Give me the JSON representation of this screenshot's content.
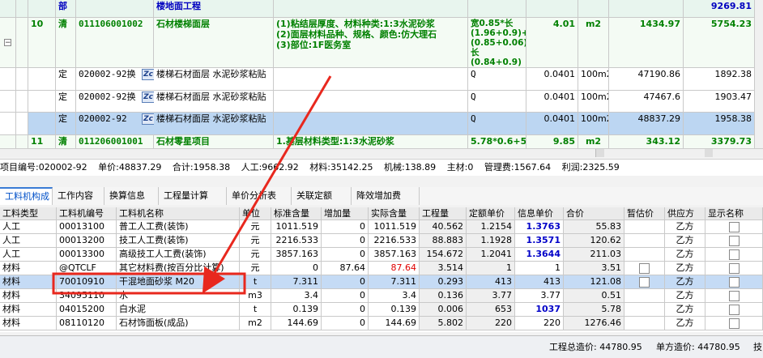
{
  "top_grid": {
    "rows": [
      {
        "type": "part",
        "seq": "",
        "kind": "部",
        "code": "",
        "name": "楼地面工程",
        "features": "",
        "formula": "",
        "qty": "",
        "unit": "",
        "price": "",
        "total": "9269.81"
      },
      {
        "type": "qd",
        "seq": "10",
        "kind": "清",
        "code": "011106001002",
        "name": "石材楼梯面层",
        "features": "(1)粘结层厚度、材料种类:1:3水泥砂浆\n(2)面层材料品种、规格、颜色:仿大理石\n(3)部位:1F医务室",
        "formula": "宽0.85*长(1.96+0.9)+宽(0.85+0.06)*长(0.84+0.9)",
        "qty": "4.01",
        "unit": "m2",
        "price": "1434.97",
        "total": "5754.23"
      },
      {
        "type": "de",
        "seq": "",
        "kind": "定",
        "code": "020002-92换",
        "name": "楼梯石材面层 水泥砂浆粘贴",
        "features": "",
        "formula": "Q",
        "qty": "0.0401",
        "unit": "100m2",
        "price": "47190.86",
        "total": "1892.38"
      },
      {
        "type": "de",
        "seq": "",
        "kind": "定",
        "code": "020002-92换",
        "name": "楼梯石材面层 水泥砂浆粘贴",
        "features": "",
        "formula": "Q",
        "qty": "0.0401",
        "unit": "100m2",
        "price": "47467.6",
        "total": "1903.47"
      },
      {
        "type": "sel",
        "seq": "",
        "kind": "定",
        "code": "020002-92",
        "name": "楼梯石材面层 水泥砂浆粘贴",
        "features": "",
        "formula": "Q",
        "qty": "0.0401",
        "unit": "100m2",
        "price": "48837.29",
        "total": "1958.38"
      },
      {
        "type": "qd2",
        "seq": "11",
        "kind": "清",
        "code": "011206001001",
        "name": "石材零星项目",
        "features": "1.基层材料类型:1:3水泥砂浆",
        "formula": "5.78*0.6+5",
        "qty": "9.85",
        "unit": "m2",
        "price": "343.12",
        "total": "3379.73"
      }
    ]
  },
  "info": {
    "code": "项目编号:020002-92",
    "unit_price": "单价:48837.29",
    "total": "合计:1958.38",
    "labor": "人工:9662.92",
    "material": "材料:35142.25",
    "machine": "机械:138.89",
    "main_mat": "主材:0",
    "mgmt": "管理费:1567.64",
    "profit": "利润:2325.59"
  },
  "tabs": [
    "工料机构成",
    "工作内容",
    "换算信息",
    "工程量计算",
    "单价分析表",
    "关联定额",
    "降效增加费"
  ],
  "grid": {
    "headers": [
      "工料类型",
      "工料机编号",
      "工料机名称",
      "单位",
      "标准含量",
      "增加量",
      "实际含量",
      "工程量",
      "定额单价",
      "信息单价",
      "合价",
      "暂估价",
      "供应方",
      "显示名称"
    ],
    "rows": [
      {
        "type": "人工",
        "code": "00013100",
        "name": "普工人工费(装饰)",
        "unit": "元",
        "std": "1011.519",
        "add": "0",
        "act": "1011.519",
        "qty": "40.562",
        "dprice": "1.2154",
        "iprice": "1.3763",
        "total": "55.83",
        "supplier": "乙方"
      },
      {
        "type": "人工",
        "code": "00013200",
        "name": "技工人工费(装饰)",
        "unit": "元",
        "std": "2216.533",
        "add": "0",
        "act": "2216.533",
        "qty": "88.883",
        "dprice": "1.1928",
        "iprice": "1.3571",
        "total": "120.62",
        "supplier": "乙方"
      },
      {
        "type": "人工",
        "code": "00013300",
        "name": "高级技工人工费(装饰)",
        "unit": "元",
        "std": "3857.163",
        "add": "0",
        "act": "3857.163",
        "qty": "154.672",
        "dprice": "1.2041",
        "iprice": "1.3644",
        "total": "211.03",
        "supplier": "乙方"
      },
      {
        "type": "材料",
        "code": "@QTCLF",
        "name": "其它材料费(按百分比计算)",
        "unit": "元",
        "std": "0",
        "add": "87.64",
        "act": "87.64",
        "qty": "3.514",
        "dprice": "1",
        "iprice": "1",
        "total": "3.51",
        "supplier": "乙方"
      },
      {
        "type": "材料",
        "code": "70010910",
        "name": "干混地面砂浆 M20",
        "unit": "t",
        "std": "7.311",
        "add": "0",
        "act": "7.311",
        "qty": "0.293",
        "dprice": "413",
        "iprice": "413",
        "total": "121.08",
        "supplier": "乙方"
      },
      {
        "type": "材料",
        "code": "34095110",
        "name": "水",
        "unit": "m3",
        "std": "3.4",
        "add": "0",
        "act": "3.4",
        "qty": "0.136",
        "dprice": "3.77",
        "iprice": "3.77",
        "total": "0.51",
        "supplier": "乙方"
      },
      {
        "type": "材料",
        "code": "04015200",
        "name": "白水泥",
        "unit": "t",
        "std": "0.139",
        "add": "0",
        "act": "0.139",
        "qty": "0.006",
        "dprice": "653",
        "iprice": "1037",
        "total": "5.78",
        "supplier": "乙方"
      },
      {
        "type": "材料",
        "code": "08110120",
        "name": "石材饰面板(成品)",
        "unit": "m2",
        "std": "144.69",
        "add": "0",
        "act": "144.69",
        "qty": "5.802",
        "dprice": "220",
        "iprice": "220",
        "total": "1276.46",
        "supplier": "乙方"
      }
    ]
  },
  "footer": {
    "total_cost": "工程总造价: 44780.95",
    "unit_cost": "单方造价: 44780.95",
    "trailing": "技"
  },
  "colors": {
    "accent_red": "#e8281e",
    "selection": "#bcd6f2",
    "green_text": "#008000"
  }
}
